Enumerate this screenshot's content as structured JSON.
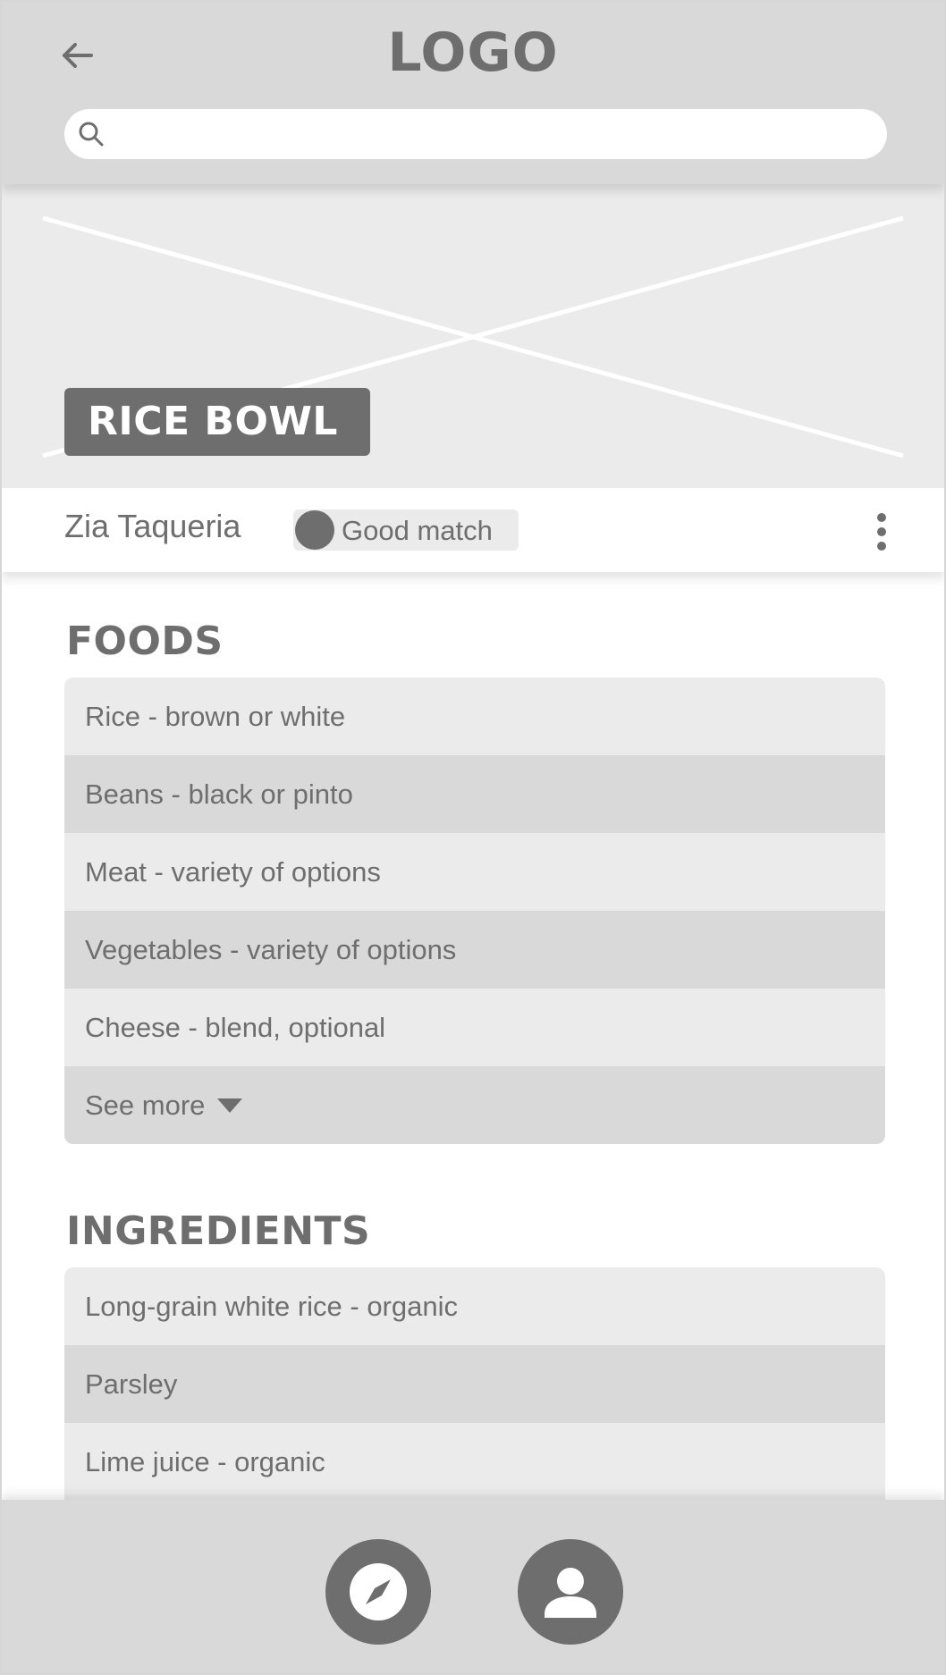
{
  "header": {
    "logo": "LOGO",
    "search_placeholder": ""
  },
  "hero": {
    "title": "RICE BOWL"
  },
  "restaurant": {
    "name": "Zia Taqueria",
    "match_label": "Good match"
  },
  "foods": {
    "title": "FOODS",
    "items": [
      "Rice - brown or white",
      "Beans - black or pinto",
      "Meat - variety of options",
      "Vegetables - variety of options",
      "Cheese - blend, optional"
    ],
    "see_more": "See more"
  },
  "ingredients": {
    "title": "INGREDIENTS",
    "items": [
      "Long-grain white rice - organic",
      "Parsley",
      "Lime juice - organic"
    ]
  },
  "icons": {
    "back": "arrow-left-icon",
    "search": "search-icon",
    "more": "more-vertical-icon",
    "nav_explore": "compass-icon",
    "nav_profile": "person-icon"
  },
  "colors": {
    "header_bg": "#d9d9d9",
    "dark_gray": "#6e6e6e",
    "light_gray": "#ebebeb"
  }
}
